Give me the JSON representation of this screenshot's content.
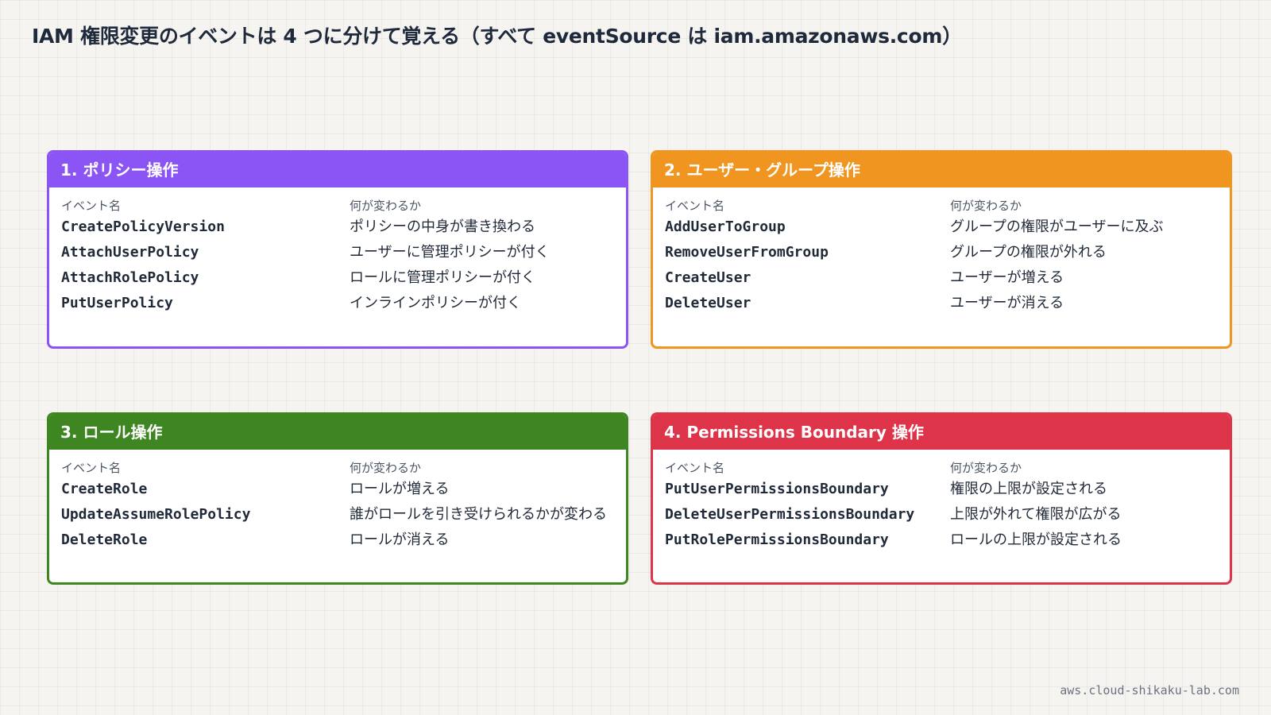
{
  "title": "IAM 権限変更のイベントは 4 つに分けて覚える（すべて eventSource は iam.amazonaws.com）",
  "footer": "aws.cloud-shikaku-lab.com",
  "column_headers": {
    "event": "イベント名",
    "change": "何が変わるか"
  },
  "cards": [
    {
      "title": "1. ポリシー操作",
      "color": "#8b55f6",
      "rows": [
        {
          "event": "CreatePolicyVersion",
          "change": "ポリシーの中身が書き換わる"
        },
        {
          "event": "AttachUserPolicy",
          "change": "ユーザーに管理ポリシーが付く"
        },
        {
          "event": "AttachRolePolicy",
          "change": "ロールに管理ポリシーが付く"
        },
        {
          "event": "PutUserPolicy",
          "change": "インラインポリシーが付く"
        }
      ]
    },
    {
      "title": "2. ユーザー・グループ操作",
      "color": "#ef9520",
      "rows": [
        {
          "event": "AddUserToGroup",
          "change": "グループの権限がユーザーに及ぶ"
        },
        {
          "event": "RemoveUserFromGroup",
          "change": "グループの権限が外れる"
        },
        {
          "event": "CreateUser",
          "change": "ユーザーが増える"
        },
        {
          "event": "DeleteUser",
          "change": "ユーザーが消える"
        }
      ]
    },
    {
      "title": "3. ロール操作",
      "color": "#3e8622",
      "rows": [
        {
          "event": "CreateRole",
          "change": "ロールが増える"
        },
        {
          "event": "UpdateAssumeRolePolicy",
          "change": "誰がロールを引き受けられるかが変わる"
        },
        {
          "event": "DeleteRole",
          "change": "ロールが消える"
        }
      ]
    },
    {
      "title": "4. Permissions Boundary 操作",
      "color": "#dd3449",
      "rows": [
        {
          "event": "PutUserPermissionsBoundary",
          "change": "権限の上限が設定される"
        },
        {
          "event": "DeleteUserPermissionsBoundary",
          "change": "上限が外れて権限が広がる"
        },
        {
          "event": "PutRolePermissionsBoundary",
          "change": "ロールの上限が設定される"
        }
      ]
    }
  ]
}
